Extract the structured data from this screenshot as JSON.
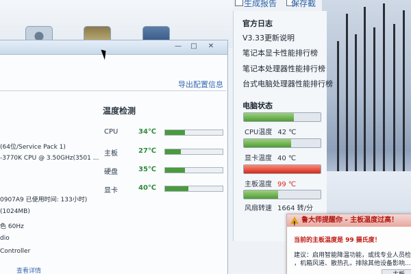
{
  "top_links": {
    "report": "生成报告",
    "save": "保存截图"
  },
  "right_panel": {
    "header": "官方日志",
    "items": [
      "V3.33更新说明",
      "笔记本显卡性能排行榜",
      "笔记本处理器性能排行榜",
      "台式电脑处理器性能排行榜"
    ],
    "status_title": "电脑状态",
    "status": [
      {
        "label": "CPU温度",
        "value": "42 ℃",
        "fill": 0.65,
        "color": "#4f9c36"
      },
      {
        "label": "显卡温度",
        "value": "40 ℃",
        "fill": 0.62,
        "color": "#4f9c36"
      },
      {
        "label": "主板温度",
        "value": "99 ℃",
        "fill": 1.0,
        "color": "#d22a18"
      },
      {
        "label": "风扇转速",
        "value": "1664 转/分",
        "fill": 0.45,
        "color": "#4f9c36"
      }
    ]
  },
  "window": {
    "export": "导出配置信息",
    "temp_title": "温度检测",
    "temps": [
      {
        "label": "CPU",
        "value": "34℃",
        "fill": 0.34
      },
      {
        "label": "主板",
        "value": "27℃",
        "fill": 0.27
      },
      {
        "label": "硬盘",
        "value": "35℃",
        "fill": 0.35
      },
      {
        "label": "显卡",
        "value": "40℃",
        "fill": 0.4
      }
    ],
    "info_lines": [
      "(64位/Service Pack 1)",
      "-3770K CPU @ 3.50GHz(3501 ...",
      "0907A9 已使用时间: 133小时)",
      "(1024MB)",
      "色 60Hz",
      "dio",
      "Controller"
    ],
    "details": "查看详情"
  },
  "popup": {
    "title": "鲁大师提醒你 - 主板温度过高！",
    "main": "当前的主板温度是 99 摄氏度！",
    "line1": "建议：启用智能降温功能，或找专业人员检查",
    "line2": "，机箱风道、散热孔，排除其他设备影响...",
    "button": "主板"
  },
  "colors": {
    "accent": "#3b6cb2",
    "alert": "#d22a18",
    "ok": "#4f9c36"
  }
}
